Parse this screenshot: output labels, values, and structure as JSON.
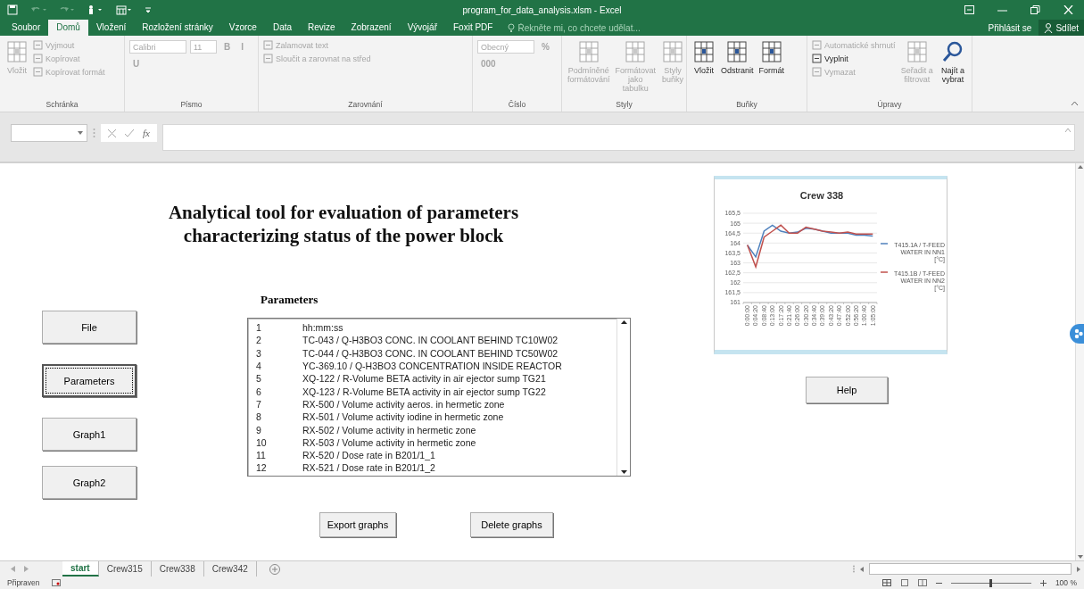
{
  "window": {
    "title": "program_for_data_analysis.xlsm - Excel"
  },
  "ribbon_tabs": [
    {
      "label": "Soubor",
      "selected": false
    },
    {
      "label": "Domů",
      "selected": true
    },
    {
      "label": "Vložení",
      "selected": false
    },
    {
      "label": "Rozložení stránky",
      "selected": false
    },
    {
      "label": "Vzorce",
      "selected": false
    },
    {
      "label": "Data",
      "selected": false
    },
    {
      "label": "Revize",
      "selected": false
    },
    {
      "label": "Zobrazení",
      "selected": false
    },
    {
      "label": "Vývojář",
      "selected": false
    },
    {
      "label": "Foxit PDF",
      "selected": false
    }
  ],
  "tell_me": {
    "placeholder": "Řekněte mi, co chcete udělat..."
  },
  "account": {
    "sign_in": "Přihlásit se",
    "share": "Sdílet"
  },
  "ribbon_groups": [
    {
      "name": "Schránka",
      "controls": [
        {
          "kind": "large",
          "label": "Vložit",
          "disabled": true
        },
        {
          "kind": "small",
          "label": "Vyjmout",
          "disabled": true
        },
        {
          "kind": "small",
          "label": "Kopírovat",
          "disabled": true
        },
        {
          "kind": "small",
          "label": "Kopírovat formát",
          "disabled": true
        }
      ]
    },
    {
      "name": "Písmo",
      "controls": [
        {
          "kind": "field",
          "value": "Calibri",
          "disabled": true
        },
        {
          "kind": "field",
          "value": "11",
          "disabled": true
        },
        {
          "kind": "glyph",
          "label": "B",
          "disabled": true
        },
        {
          "kind": "glyph",
          "label": "I",
          "disabled": true
        },
        {
          "kind": "glyph",
          "label": "U",
          "disabled": true
        }
      ]
    },
    {
      "name": "Zarovnání",
      "controls": [
        {
          "kind": "small",
          "label": "Zalamovat text",
          "disabled": true
        },
        {
          "kind": "small",
          "label": "Sloučit a zarovnat na střed",
          "disabled": true
        }
      ]
    },
    {
      "name": "Číslo",
      "controls": [
        {
          "kind": "field",
          "value": "Obecný",
          "disabled": true
        },
        {
          "kind": "glyph",
          "label": "%",
          "disabled": true
        },
        {
          "kind": "glyph",
          "label": "000",
          "disabled": true
        }
      ]
    },
    {
      "name": "Styly",
      "controls": [
        {
          "kind": "large",
          "label": "Podmíněné formátování",
          "disabled": true
        },
        {
          "kind": "large",
          "label": "Formátovat jako tabulku",
          "disabled": true
        },
        {
          "kind": "large",
          "label": "Styly buňky",
          "disabled": true
        }
      ]
    },
    {
      "name": "Buňky",
      "controls": [
        {
          "kind": "large",
          "label": "Vložit",
          "disabled": false
        },
        {
          "kind": "large",
          "label": "Odstranit",
          "disabled": false
        },
        {
          "kind": "large",
          "label": "Formát",
          "disabled": false
        }
      ]
    },
    {
      "name": "Úpravy",
      "controls": [
        {
          "kind": "small",
          "label": "Automatické shrnutí",
          "disabled": true
        },
        {
          "kind": "small",
          "label": "Vyplnit",
          "disabled": false
        },
        {
          "kind": "small",
          "label": "Vymazat",
          "disabled": true
        },
        {
          "kind": "large",
          "label": "Seřadit a filtrovat",
          "disabled": true
        },
        {
          "kind": "search",
          "label": "Najít a vybrat",
          "disabled": false
        }
      ]
    }
  ],
  "formula_bar": {
    "function_button": "fx"
  },
  "sheet": {
    "title": "Analytical tool for evaluation of parameters characterizing status of the power block",
    "nav_buttons": [
      {
        "label": "File",
        "selected": false
      },
      {
        "label": "Parameters",
        "selected": true
      },
      {
        "label": "Graph1",
        "selected": false
      },
      {
        "label": "Graph2",
        "selected": false
      }
    ],
    "parameters_label": "Parameters",
    "parameters_list": [
      {
        "number": "1",
        "name": "hh:mm:ss"
      },
      {
        "number": "2",
        "name": "TC-043 / Q-H3BO3 CONC. IN COOLANT BEHIND TC10W02"
      },
      {
        "number": "3",
        "name": "TC-044 / Q-H3BO3 CONC. IN COOLANT BEHIND TC50W02"
      },
      {
        "number": "4",
        "name": "YC-369.10 / Q-H3BO3 CONCENTRATION INSIDE REACTOR"
      },
      {
        "number": "5",
        "name": "XQ-122 / R-Volume BETA activity in air ejector sump TG21"
      },
      {
        "number": "6",
        "name": "XQ-123 / R-Volume BETA activity in air ejector sump TG22"
      },
      {
        "number": "7",
        "name": "RX-500 / Volume activity aeros. in hermetic zone"
      },
      {
        "number": "8",
        "name": "RX-501 / Volume activity iodine in hermetic zone"
      },
      {
        "number": "9",
        "name": "RX-502 / Volume activity in hermetic zone"
      },
      {
        "number": "10",
        "name": "RX-503 / Volume activity in hermetic zone"
      },
      {
        "number": "11",
        "name": "RX-520 / Dose rate in B201/1_1"
      },
      {
        "number": "12",
        "name": "RX-521 / Dose rate in B201/1_2"
      }
    ],
    "action_buttons": [
      "Export graphs",
      "Delete graphs"
    ],
    "help_button": "Help",
    "chart": {
      "chart_data": {
        "type": "line",
        "title": "Crew 338",
        "categories": [
          "0:00:00",
          "0:04:20",
          "0:08:40",
          "0:13:00",
          "0:17:20",
          "0:21:40",
          "0:26:00",
          "0:30:20",
          "0:34:40",
          "0:39:00",
          "0:43:20",
          "0:47:40",
          "0:52:00",
          "0:56:20",
          "1:00:40",
          "1:05:00"
        ],
        "series": [
          {
            "name": "T415.1A / T-FEED WATER IN NN1 [°C]",
            "color": "#4f81bd",
            "values": [
              163.9,
              163.3,
              164.6,
              164.9,
              164.6,
              164.5,
              164.55,
              164.75,
              164.7,
              164.6,
              164.5,
              164.5,
              164.5,
              164.4,
              164.4,
              164.35
            ]
          },
          {
            "name": "T415.1B / T-FEED WATER IN NN2 [°C]",
            "color": "#c0504d",
            "values": [
              163.9,
              162.8,
              164.3,
              164.6,
              164.9,
              164.5,
              164.5,
              164.8,
              164.7,
              164.6,
              164.55,
              164.5,
              164.55,
              164.45,
              164.45,
              164.45
            ]
          }
        ],
        "ylim": [
          161,
          165.5
        ],
        "grid": true,
        "yticks": [
          {
            "value": 161,
            "label": "161"
          },
          {
            "value": 161.5,
            "label": "161,5"
          },
          {
            "value": 162,
            "label": "162"
          },
          {
            "value": 162.5,
            "label": "162,5"
          },
          {
            "value": 163,
            "label": "163"
          },
          {
            "value": 163.5,
            "label": "163,5"
          },
          {
            "value": 164,
            "label": "164"
          },
          {
            "value": 164.5,
            "label": "164,5"
          },
          {
            "value": 165,
            "label": "165"
          },
          {
            "value": 165.5,
            "label": "165,5"
          }
        ]
      }
    }
  },
  "sheet_tabs": [
    {
      "label": "start",
      "selected": true
    },
    {
      "label": "Crew315",
      "selected": false
    },
    {
      "label": "Crew338",
      "selected": false
    },
    {
      "label": "Crew342",
      "selected": false
    }
  ],
  "status_bar": {
    "status": "Připraven",
    "zoom": "100 %",
    "zoom_slider": {
      "level": 0.5
    }
  }
}
